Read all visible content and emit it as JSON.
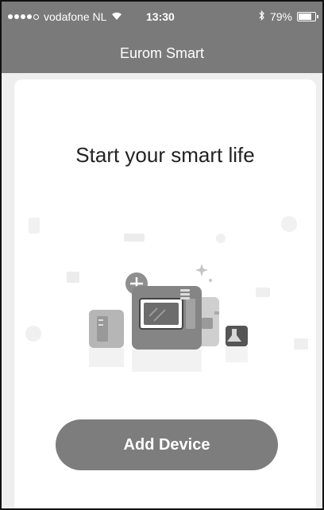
{
  "status_bar": {
    "carrier": "vodafone NL",
    "time": "13:30",
    "battery": "79%",
    "signal_level": 4,
    "signal_max": 5,
    "battery_level": 0.79,
    "icons": [
      "signal-dots-icon",
      "wifi-icon",
      "bluetooth-icon",
      "battery-icon"
    ]
  },
  "navbar": {
    "title": "Eurom Smart"
  },
  "main": {
    "headline": "Start your smart life",
    "illustration_icon": "smart-devices-illustration",
    "add_button_label": "Add Device"
  },
  "colors": {
    "bar": "#7a7a7a",
    "button": "#7d7d7d",
    "card": "#ffffff"
  }
}
